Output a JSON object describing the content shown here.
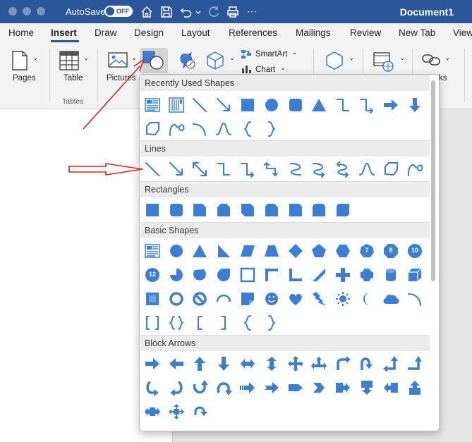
{
  "titlebar": {
    "autosave_label": "AutoSave",
    "autosave_state": "OFF",
    "document_title": "Document1",
    "icons": [
      "home-icon",
      "save-icon",
      "undo-icon",
      "redo-icon",
      "print-icon",
      "more-icon"
    ]
  },
  "tabs": [
    "Home",
    "Insert",
    "Draw",
    "Design",
    "Layout",
    "References",
    "Mailings",
    "Review",
    "New Tab",
    "View"
  ],
  "active_tab": "Insert",
  "ribbon": {
    "pages_label": "Pages",
    "table_label": "Table",
    "tables_group_label": "Tables",
    "pictures_label": "Pictures",
    "smartart_label": "SmartArt",
    "chart_label": "Chart",
    "partial_label": "ks"
  },
  "shapes_menu": {
    "sections": [
      {
        "title": "Recently Used Shapes",
        "shapes": [
          [
            "text-box",
            "vertical-text-box",
            "line",
            "arrow-line",
            "rectangle",
            "oval",
            "rounded-rectangle",
            "triangle",
            "elbow-connector",
            "elbow-arrow-connector",
            "right-arrow",
            "down-arrow"
          ],
          [
            "freeform",
            "scribble",
            "arc",
            "curve",
            "left-brace",
            "right-brace"
          ]
        ]
      },
      {
        "title": "Lines",
        "shapes": [
          [
            "line",
            "arrow-line",
            "double-arrow-line",
            "elbow-connector",
            "elbow-arrow-connector",
            "elbow-double-arrow",
            "curved-connector",
            "curved-arrow-connector",
            "curved-double-arrow",
            "curve",
            "freeform",
            "scribble"
          ]
        ]
      },
      {
        "title": "Rectangles",
        "shapes": [
          [
            "rectangle",
            "rounded-rectangle",
            "snip-single-corner",
            "snip-same-side",
            "snip-diagonal",
            "snip-round",
            "round-single-corner",
            "round-same-side",
            "round-diagonal"
          ]
        ]
      },
      {
        "title": "Basic Shapes",
        "shapes": [
          [
            "text-box",
            "oval",
            "triangle",
            "right-triangle",
            "parallelogram",
            "trapezoid",
            "diamond",
            "pentagon",
            "hexagon",
            "heptagon",
            "octagon",
            "decagon"
          ],
          [
            "dodecagon",
            "pie",
            "chord",
            "teardrop",
            "frame",
            "half-frame",
            "l-shape",
            "diagonal-stripe",
            "cross",
            "plaque",
            "can",
            "cube"
          ],
          [
            "bevel",
            "donut",
            "no-symbol",
            "block-arc",
            "folded-corner",
            "smiley",
            "heart",
            "lightning",
            "sun",
            "moon",
            "cloud",
            "arc"
          ],
          [
            "double-bracket",
            "double-brace",
            "left-bracket",
            "right-bracket",
            "left-brace",
            "right-brace"
          ]
        ]
      },
      {
        "title": "Block Arrows",
        "shapes": [
          [
            "right-arrow",
            "left-arrow",
            "up-arrow",
            "down-arrow",
            "left-right-arrow",
            "up-down-arrow",
            "quad-arrow",
            "left-right-up-arrow",
            "bent-arrow",
            "u-turn-arrow",
            "left-up-arrow",
            "bent-up-arrow"
          ],
          [
            "curved-right-arrow",
            "curved-left-arrow",
            "curved-up-arrow",
            "curved-down-arrow",
            "striped-right-arrow",
            "notched-right-arrow",
            "pentagon-arrow",
            "chevron",
            "right-arrow-callout",
            "down-arrow-callout",
            "left-arrow-callout",
            "up-arrow-callout"
          ],
          [
            "left-right-arrow-callout",
            "quad-arrow-callout",
            "circular-arrow"
          ]
        ]
      }
    ],
    "badges": {
      "heptagon": "7",
      "octagon": "8",
      "decagon": "10",
      "dodecagon": "12"
    }
  },
  "colors": {
    "accent": "#2b579a",
    "shape": "#3a7fd5",
    "annotation": "#e02020"
  }
}
